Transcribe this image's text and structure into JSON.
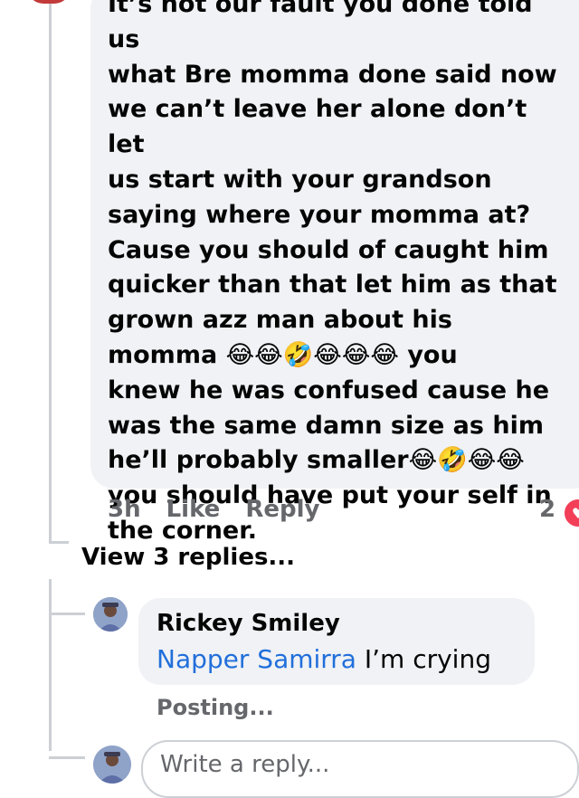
{
  "comment": {
    "text": "It’s not our fault you done told us\nwhat Bre momma done said now\nwe can’t leave her alone don’t let\nus start with your grandson\nsaying where your momma at?\nCause you should of caught him\nquicker than that let him as that\ngrown azz man about his\nmomma 😂😂🤣😂😂😂 you\nknew he was confused cause he\nwas the same damn size as him\nhe’ll probably smaller😂🤣😂😂\nyou should have put your self in\nthe corner.",
    "time": "3h",
    "like_label": "Like",
    "reply_label": "Reply",
    "reaction_count": "2"
  },
  "view_replies_label": "View 3 replies...",
  "reply": {
    "author": "Rickey Smiley",
    "mention": "Napper Samirra",
    "message": " I’m crying",
    "status": "Posting..."
  },
  "composer": {
    "placeholder": "Write a reply..."
  },
  "colors": {
    "bubble": "#f0f2f5",
    "link": "#216fdb",
    "muted": "#65676b",
    "reaction": "#f33e58"
  },
  "icons": {
    "reaction": "heart-icon"
  }
}
